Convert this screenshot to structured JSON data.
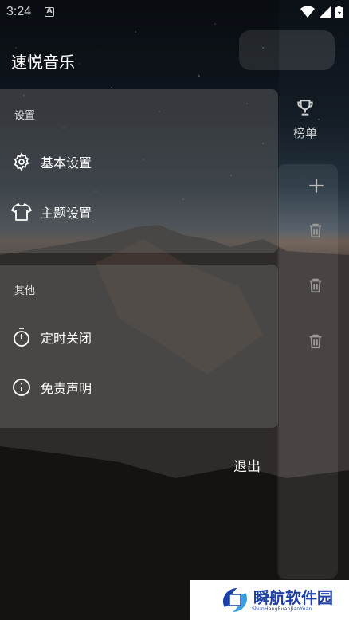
{
  "status_bar": {
    "time": "3:24",
    "notif_icon": "A"
  },
  "app": {
    "title": "速悦音乐"
  },
  "drawer": {
    "sections": [
      {
        "label": "设置",
        "items": [
          {
            "label": "基本设置",
            "icon": "gear-icon"
          },
          {
            "label": "主题设置",
            "icon": "tshirt-icon"
          }
        ]
      },
      {
        "label": "其他",
        "items": [
          {
            "label": "定时关闭",
            "icon": "timer-icon"
          },
          {
            "label": "免责声明",
            "icon": "info-icon"
          }
        ]
      }
    ],
    "exit_label": "退出"
  },
  "background_page": {
    "rank_label": "榜单"
  },
  "watermark": {
    "text": "瞬航软件园",
    "sub": "ShunHangRuanJianYuan"
  },
  "colors": {
    "panel": "#6e6e6e",
    "text": "#ffffff",
    "watermark": "#1e3fa8"
  }
}
